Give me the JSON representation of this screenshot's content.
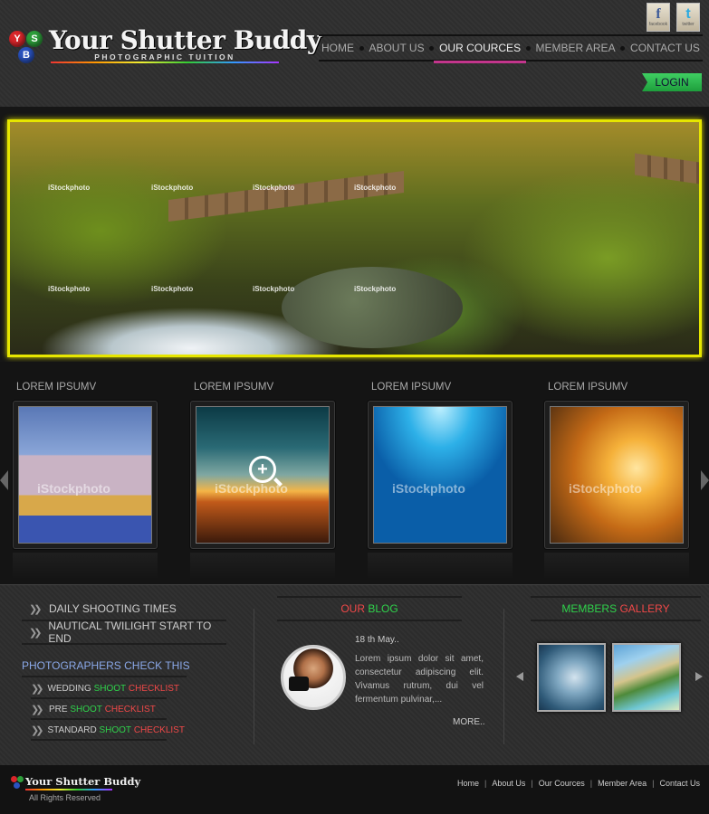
{
  "header": {
    "logo_letters": [
      "Y",
      "S",
      "B"
    ],
    "logo_title": "Your Shutter Buddy",
    "logo_subtitle": "PHOTOGRAPHIC TUITION",
    "social": [
      {
        "label": "facebook",
        "glyph": "f"
      },
      {
        "label": "twitter",
        "glyph": "t"
      }
    ],
    "nav": [
      "HOME",
      "ABOUT US",
      "OUR COURCES",
      "MEMBER AREA",
      "CONTACT US"
    ],
    "active_nav": "OUR COURCES",
    "login_label": "LOGIN"
  },
  "banner": {
    "watermark": "iStockphoto"
  },
  "gallery": {
    "cards": [
      {
        "title": "LOREM IPSUMV"
      },
      {
        "title": "LOREM IPSUMV"
      },
      {
        "title": "LOREM IPSUMV"
      },
      {
        "title": "LOREM IPSUMV"
      }
    ],
    "zoom_glyph": "+",
    "watermark": "iStockphoto"
  },
  "links": {
    "items": [
      "DAILY SHOOTING TIMES",
      "NAUTICAL TWILIGHT START TO END"
    ],
    "check_heading": "PHOTOGRAPHERS CHECK THIS",
    "checklist": [
      {
        "pre": "WEDDING",
        "mid": "SHOOT",
        "post": "CHECKLIST"
      },
      {
        "pre": "PRE",
        "mid": "SHOOT",
        "post": "CHECKLIST"
      },
      {
        "pre": "STANDARD",
        "mid": "SHOOT",
        "post": "CHECKLIST"
      }
    ]
  },
  "blog": {
    "title_a": "OUR",
    "title_b": "BLOG",
    "date": "18 th May..",
    "text": "Lorem ipsum dolor sit amet, consectetur adipiscing elit. Vivamus rutrum, dui vel fermentum pulvinar,...",
    "more": "MORE.."
  },
  "members_gallery": {
    "title_a": "MEMBERS",
    "title_b": "GALLERY"
  },
  "footer": {
    "logo_title": "Your Shutter Buddy",
    "rights": "All Rights Reserved",
    "nav": [
      "Home",
      "About Us",
      "Our Cources",
      "Member Area",
      "Contact Us"
    ]
  },
  "colors": {
    "accent_green": "#2fd24b",
    "accent_red": "#f04848",
    "accent_pink": "#c3358c",
    "banner_border": "#e6e600",
    "heading_blue": "#8aa8e8"
  }
}
